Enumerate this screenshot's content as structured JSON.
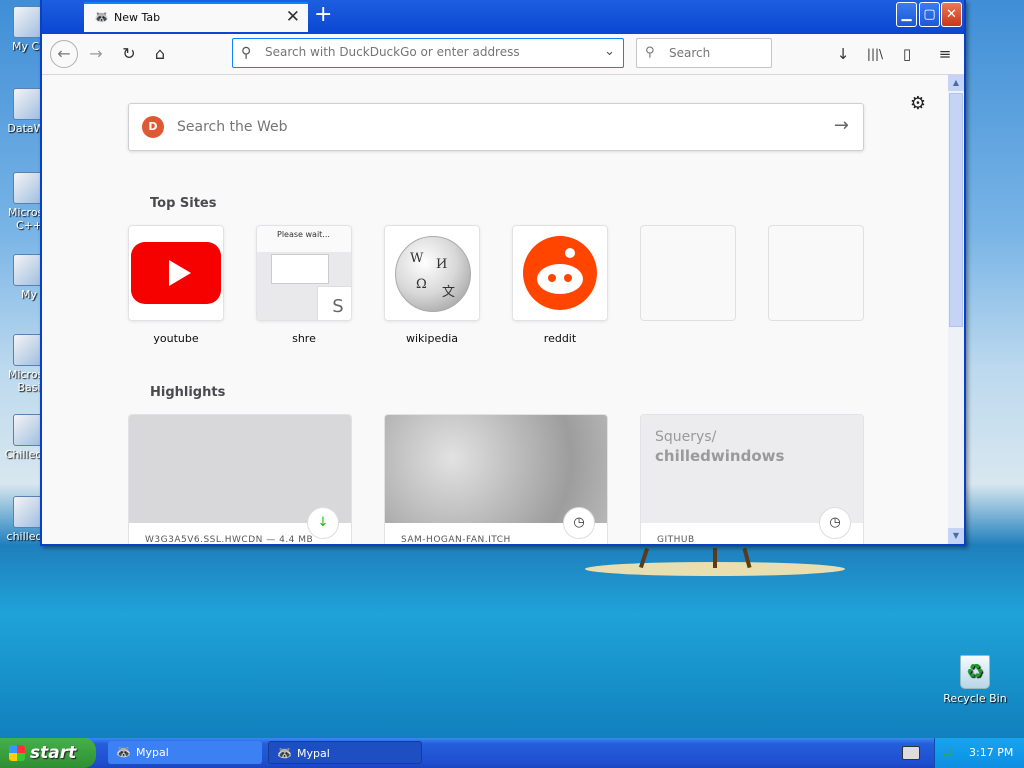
{
  "desktop": {
    "icons": [
      {
        "label": "My Co"
      },
      {
        "label": "DataWa"
      },
      {
        "label": "Microso\nC++"
      },
      {
        "label": "My"
      },
      {
        "label": "Microso\nBasi"
      },
      {
        "label": "ChilledW"
      },
      {
        "label": "chilledw"
      }
    ],
    "recycle_bin": "Recycle Bin"
  },
  "browser": {
    "tab": {
      "title": "New Tab",
      "close": "✕"
    },
    "new_tab": "+",
    "window_buttons": {
      "minimize": "▁",
      "maximize": "▢",
      "close": "✕"
    },
    "toolbar": {
      "back": "←",
      "forward": "→",
      "reload": "↻",
      "home": "⌂",
      "address_placeholder": "Search with DuckDuckGo or enter address",
      "search_placeholder": "Search",
      "downloads": "↓",
      "library": "|||\\",
      "sidebar": "▯",
      "menu": "≡"
    }
  },
  "newtab": {
    "settings": "⚙",
    "web_search": {
      "placeholder": "Search the Web",
      "engine_initial": "D",
      "go": "→"
    },
    "top_sites_title": "Top Sites",
    "top_sites": [
      {
        "label": "youtube"
      },
      {
        "label": "shre",
        "preview_text": "Please wait...",
        "badge": "S"
      },
      {
        "label": "wikipedia"
      },
      {
        "label": "reddit"
      },
      {
        "label": ""
      },
      {
        "label": ""
      }
    ],
    "highlights_title": "Highlights",
    "highlights": [
      {
        "host": "W3G3A5V6.SSL.HWCDN — 4.4 MB",
        "badge": "↓",
        "badge_color": "#12bc00"
      },
      {
        "host": "SAM-HOGAN-FAN.ITCH",
        "badge": "◷"
      },
      {
        "host": "GITHUB",
        "badge": "◷",
        "preview_line1": "Squerys/",
        "preview_line2": "chilledwindows"
      }
    ]
  },
  "taskbar": {
    "start": "start",
    "tasks": [
      {
        "label": "Mypal"
      },
      {
        "label": "Mypal"
      }
    ],
    "clock": "3:17 PM"
  },
  "colors": {
    "accent": "#0a84ff",
    "xp_title_blue": "#0a46d2",
    "youtube_red": "#f70000",
    "reddit_orange": "#ff4500",
    "start_green": "#3ca13f"
  }
}
